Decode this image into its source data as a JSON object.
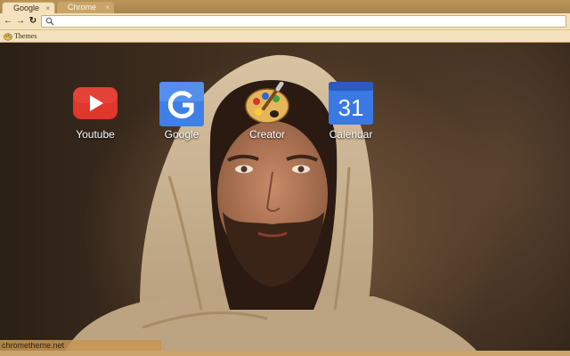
{
  "tabs": [
    {
      "label": "Google",
      "active": true
    },
    {
      "label": "Chrome",
      "active": false
    }
  ],
  "tab_close_glyph": "×",
  "toolbar": {
    "back_glyph": "←",
    "forward_glyph": "→",
    "reload_glyph": "↻",
    "search_icon": "search-icon",
    "address_value": ""
  },
  "bookmarks": [
    {
      "label": "Themes",
      "icon": "palette-icon"
    }
  ],
  "apps": [
    {
      "label": "Youtube",
      "icon": "youtube-icon"
    },
    {
      "label": "Google",
      "icon": "google-icon"
    },
    {
      "label": "Creator",
      "icon": "palette-icon"
    },
    {
      "label": "Calendar",
      "icon": "calendar-icon",
      "icon_text": "31"
    }
  ],
  "footer": {
    "watermark": "chrometheme.net"
  },
  "colors": {
    "frame": "#b9955a",
    "toolbar": "#f3e2bd",
    "youtube_red": "#e0362c",
    "google_blue": "#3f7fe8",
    "calendar_blue": "#3a79e4"
  }
}
